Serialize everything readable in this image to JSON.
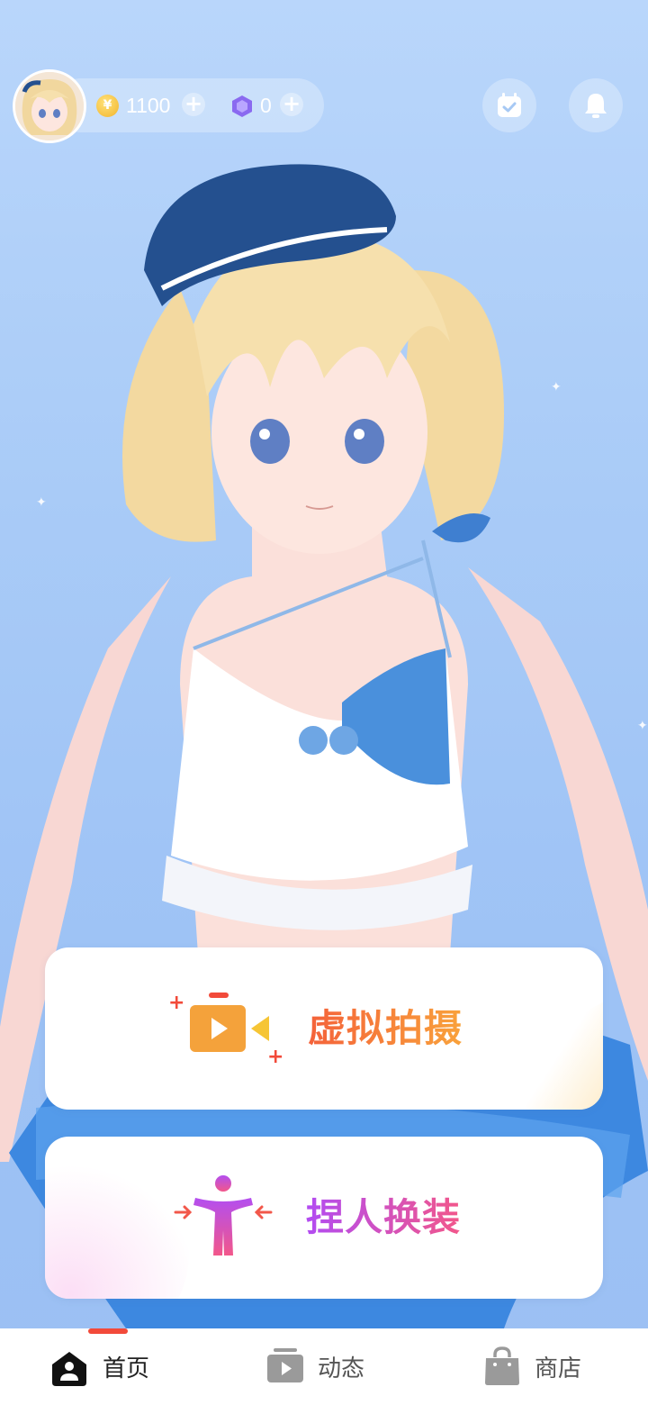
{
  "header": {
    "coins": "1100",
    "gems": "0",
    "icons": {
      "avatar": "avatar",
      "coin": "coin-icon",
      "gem": "gem-icon",
      "add": "plus-icon",
      "checkin": "calendar-check-icon",
      "notifications": "bell-icon"
    }
  },
  "actions": [
    {
      "label": "虚拟拍摄",
      "icon": "video-camera-icon",
      "accent": "#f4623a"
    },
    {
      "label": "捏人换装",
      "icon": "person-figure-icon",
      "accent": "#c24fe8"
    }
  ],
  "nav": {
    "items": [
      {
        "label": "首页",
        "icon": "home-icon",
        "active": true
      },
      {
        "label": "动态",
        "icon": "video-feed-icon",
        "active": false
      },
      {
        "label": "商店",
        "icon": "shopping-bag-icon",
        "active": false
      }
    ],
    "active_color": "#f24a3a"
  },
  "colors": {
    "background": "#a9cbf7",
    "card": "#ffffff"
  }
}
